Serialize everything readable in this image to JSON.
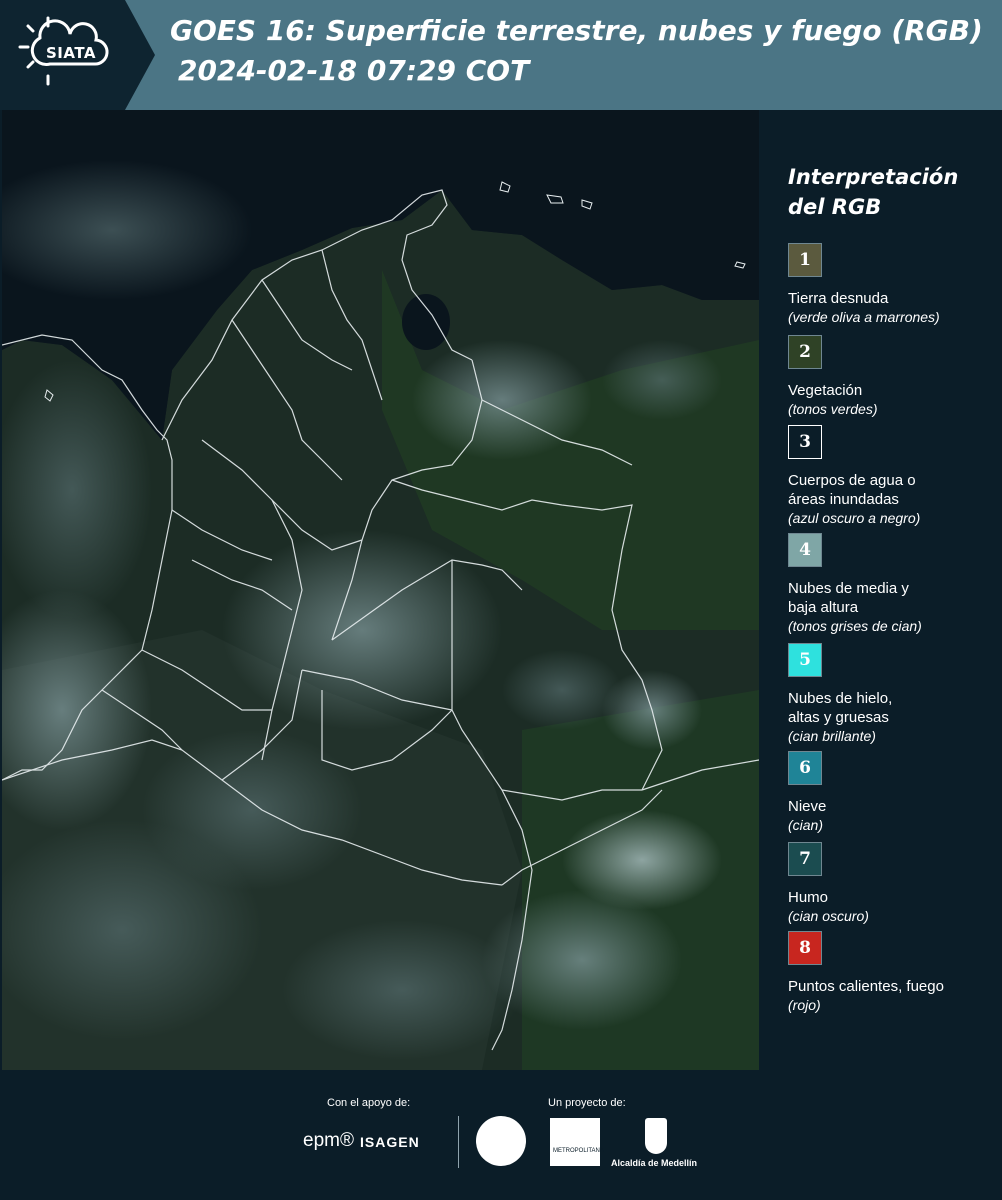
{
  "header": {
    "logo_text": "SIATA",
    "title": "GOES 16: Superficie terrestre, nubes y fuego (RGB)",
    "datetime": "2024-02-18 07:29 COT"
  },
  "legend": {
    "title_line1": "Interpretación",
    "title_line2": "del RGB",
    "items": [
      {
        "number": "1",
        "label": "Tierra desnuda",
        "sub": "(verde oliva a marrones)",
        "color": "#5b5a3e"
      },
      {
        "number": "2",
        "label": "Vegetación",
        "sub": "(tonos verdes)",
        "color": "#2f4226"
      },
      {
        "number": "3",
        "label": "Cuerpos de agua o\náreas inundadas",
        "sub": "(azul oscuro a negro)",
        "color": "#0b1d28"
      },
      {
        "number": "4",
        "label": "Nubes de media y\nbaja altura",
        "sub": "(tonos grises de cian)",
        "color": "#7fa6a6"
      },
      {
        "number": "5",
        "label": "Nubes de hielo,\naltas y gruesas",
        "sub": "(cian brillante)",
        "color": "#2ee1de"
      },
      {
        "number": "6",
        "label": "Nieve",
        "sub": "(cian)",
        "color": "#1f8497"
      },
      {
        "number": "7",
        "label": "Humo",
        "sub": "(cian oscuro)",
        "color": "#1b4c50"
      },
      {
        "number": "8",
        "label": "Puntos calientes, fuego",
        "sub": "(rojo)",
        "color": "#c8261f"
      }
    ]
  },
  "footer": {
    "support_label": "Con el apoyo de:",
    "project_label": "Un proyecto de:",
    "sponsor_epm": "epm®",
    "sponsor_isagen": "ISAGEN",
    "alcaldia": "Alcaldía de Medellín",
    "amva": "METROPOLITANA"
  }
}
